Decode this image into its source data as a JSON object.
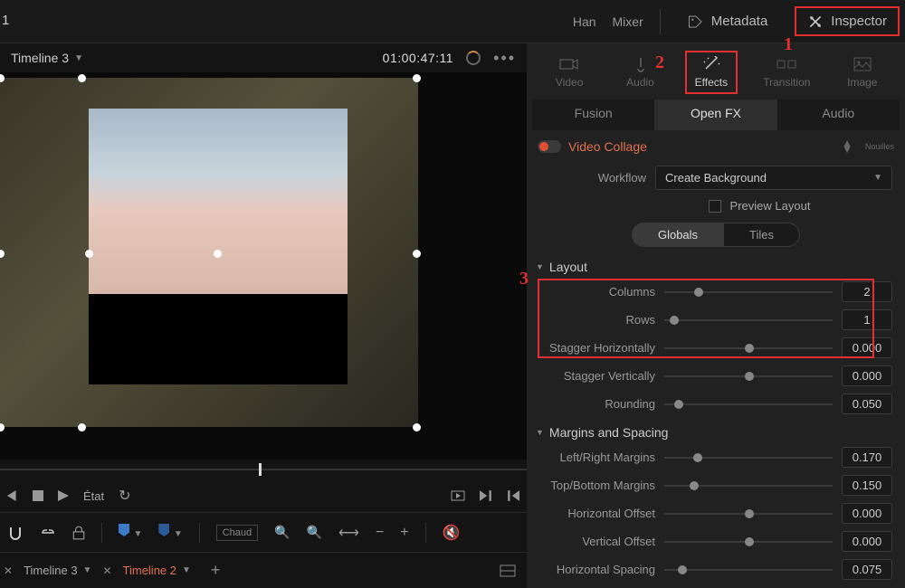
{
  "topbar": {
    "han": "Han",
    "mixer": "Mixer",
    "metadata": "Metadata",
    "inspector": "Inspector",
    "left_num": "1"
  },
  "timeline_header": {
    "title": "Timeline 3",
    "timecode": "01:00:47:11"
  },
  "transport": {
    "state_label": "État"
  },
  "toolbar": {
    "chaud": "Chaud"
  },
  "tabs": {
    "t1": "Timeline 3",
    "t2": "Timeline 2"
  },
  "inspector_tabs": {
    "video": "Video",
    "audio": "Audio",
    "effects": "Effects",
    "transition": "Transition",
    "image": "Image"
  },
  "sub_tabs": {
    "fusion": "Fusion",
    "openfx": "Open FX",
    "audio": "Audio"
  },
  "fx": {
    "name": "Video Collage",
    "tiny": "Nouilles",
    "workflow_label": "Workflow",
    "workflow_value": "Create Background",
    "preview": "Preview Layout",
    "globals": "Globals",
    "tiles": "Tiles"
  },
  "sections": {
    "layout": "Layout",
    "margins": "Margins and Spacing"
  },
  "params": {
    "columns": {
      "label": "Columns",
      "value": "2",
      "pos": 18
    },
    "rows": {
      "label": "Rows",
      "value": "1",
      "pos": 3
    },
    "stagger_h": {
      "label": "Stagger Horizontally",
      "value": "0.000",
      "pos": 48
    },
    "stagger_v": {
      "label": "Stagger Vertically",
      "value": "0.000",
      "pos": 48
    },
    "rounding": {
      "label": "Rounding",
      "value": "0.050",
      "pos": 6
    },
    "lr_margin": {
      "label": "Left/Right Margins",
      "value": "0.170",
      "pos": 17
    },
    "tb_margin": {
      "label": "Top/Bottom Margins",
      "value": "0.150",
      "pos": 15
    },
    "h_offset": {
      "label": "Horizontal Offset",
      "value": "0.000",
      "pos": 48
    },
    "v_offset": {
      "label": "Vertical Offset",
      "value": "0.000",
      "pos": 48
    },
    "h_spacing": {
      "label": "Horizontal Spacing",
      "value": "0.075",
      "pos": 8
    }
  },
  "annotations": {
    "a1": "1",
    "a2": "2",
    "a3": "3"
  }
}
